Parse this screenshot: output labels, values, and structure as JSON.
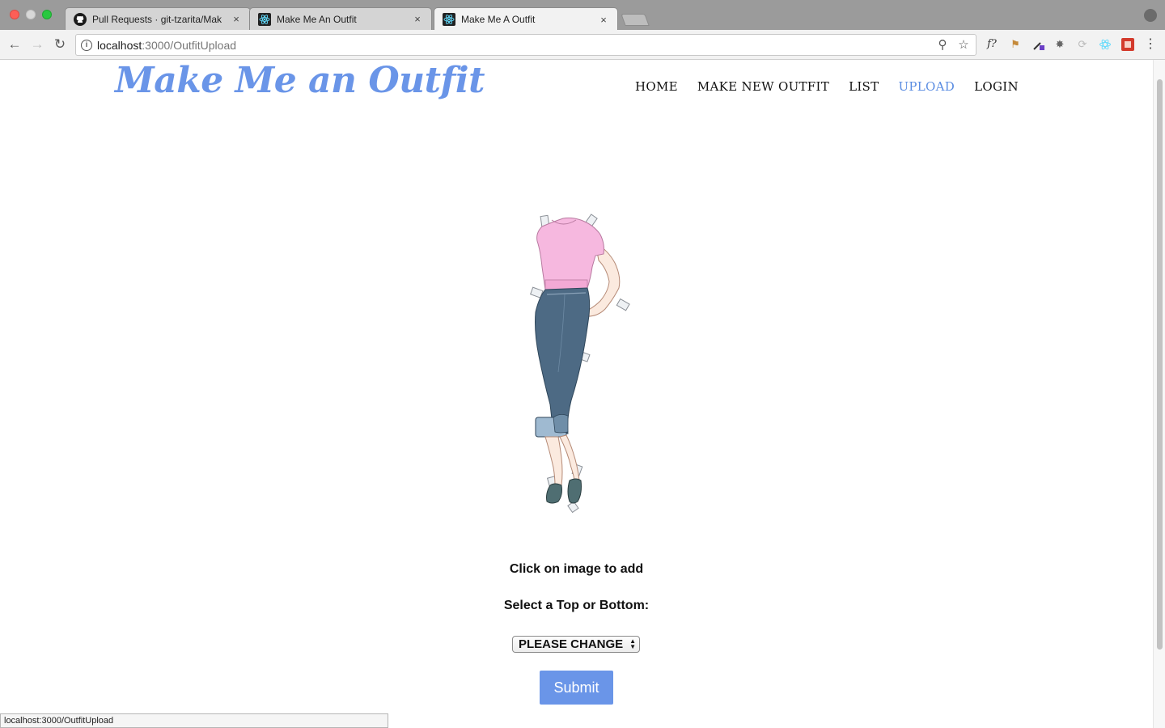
{
  "browser": {
    "tabs": [
      {
        "title": "Pull Requests · git-tzarita/Mak",
        "favicon": "github-icon",
        "close": "×"
      },
      {
        "title": "Make Me An Outfit",
        "favicon": "react-icon",
        "close": "×"
      },
      {
        "title": "Make Me A Outfit",
        "favicon": "react-icon",
        "close": "×"
      }
    ],
    "url_host": "localhost",
    "url_path": ":3000/OutfitUpload",
    "status_text": "localhost:3000/OutfitUpload"
  },
  "site": {
    "logo": "Make Me an Outfit",
    "nav": [
      {
        "label": "HOME"
      },
      {
        "label": "MAKE NEW OUTFIT"
      },
      {
        "label": "LIST"
      },
      {
        "label": "UPLOAD"
      },
      {
        "label": "LOGIN"
      }
    ],
    "active_nav": "UPLOAD",
    "accent_color": "#6a95e8"
  },
  "main": {
    "click_caption": "Click on image to add",
    "select_caption": "Select a Top or Bottom:",
    "select_value": "PLEASE CHANGE",
    "submit_label": "Submit"
  }
}
